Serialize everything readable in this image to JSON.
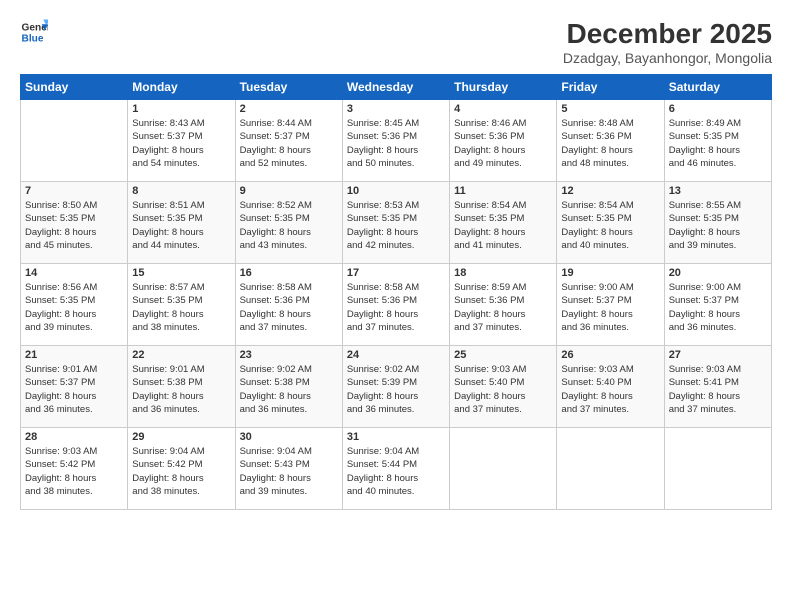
{
  "logo": {
    "line1": "General",
    "line2": "Blue"
  },
  "title": "December 2025",
  "location": "Dzadgay, Bayanhongor, Mongolia",
  "days_header": [
    "Sunday",
    "Monday",
    "Tuesday",
    "Wednesday",
    "Thursday",
    "Friday",
    "Saturday"
  ],
  "weeks": [
    [
      {
        "num": "",
        "info": ""
      },
      {
        "num": "1",
        "info": "Sunrise: 8:43 AM\nSunset: 5:37 PM\nDaylight: 8 hours\nand 54 minutes."
      },
      {
        "num": "2",
        "info": "Sunrise: 8:44 AM\nSunset: 5:37 PM\nDaylight: 8 hours\nand 52 minutes."
      },
      {
        "num": "3",
        "info": "Sunrise: 8:45 AM\nSunset: 5:36 PM\nDaylight: 8 hours\nand 50 minutes."
      },
      {
        "num": "4",
        "info": "Sunrise: 8:46 AM\nSunset: 5:36 PM\nDaylight: 8 hours\nand 49 minutes."
      },
      {
        "num": "5",
        "info": "Sunrise: 8:48 AM\nSunset: 5:36 PM\nDaylight: 8 hours\nand 48 minutes."
      },
      {
        "num": "6",
        "info": "Sunrise: 8:49 AM\nSunset: 5:35 PM\nDaylight: 8 hours\nand 46 minutes."
      }
    ],
    [
      {
        "num": "7",
        "info": "Sunrise: 8:50 AM\nSunset: 5:35 PM\nDaylight: 8 hours\nand 45 minutes."
      },
      {
        "num": "8",
        "info": "Sunrise: 8:51 AM\nSunset: 5:35 PM\nDaylight: 8 hours\nand 44 minutes."
      },
      {
        "num": "9",
        "info": "Sunrise: 8:52 AM\nSunset: 5:35 PM\nDaylight: 8 hours\nand 43 minutes."
      },
      {
        "num": "10",
        "info": "Sunrise: 8:53 AM\nSunset: 5:35 PM\nDaylight: 8 hours\nand 42 minutes."
      },
      {
        "num": "11",
        "info": "Sunrise: 8:54 AM\nSunset: 5:35 PM\nDaylight: 8 hours\nand 41 minutes."
      },
      {
        "num": "12",
        "info": "Sunrise: 8:54 AM\nSunset: 5:35 PM\nDaylight: 8 hours\nand 40 minutes."
      },
      {
        "num": "13",
        "info": "Sunrise: 8:55 AM\nSunset: 5:35 PM\nDaylight: 8 hours\nand 39 minutes."
      }
    ],
    [
      {
        "num": "14",
        "info": "Sunrise: 8:56 AM\nSunset: 5:35 PM\nDaylight: 8 hours\nand 39 minutes."
      },
      {
        "num": "15",
        "info": "Sunrise: 8:57 AM\nSunset: 5:35 PM\nDaylight: 8 hours\nand 38 minutes."
      },
      {
        "num": "16",
        "info": "Sunrise: 8:58 AM\nSunset: 5:36 PM\nDaylight: 8 hours\nand 37 minutes."
      },
      {
        "num": "17",
        "info": "Sunrise: 8:58 AM\nSunset: 5:36 PM\nDaylight: 8 hours\nand 37 minutes."
      },
      {
        "num": "18",
        "info": "Sunrise: 8:59 AM\nSunset: 5:36 PM\nDaylight: 8 hours\nand 37 minutes."
      },
      {
        "num": "19",
        "info": "Sunrise: 9:00 AM\nSunset: 5:37 PM\nDaylight: 8 hours\nand 36 minutes."
      },
      {
        "num": "20",
        "info": "Sunrise: 9:00 AM\nSunset: 5:37 PM\nDaylight: 8 hours\nand 36 minutes."
      }
    ],
    [
      {
        "num": "21",
        "info": "Sunrise: 9:01 AM\nSunset: 5:37 PM\nDaylight: 8 hours\nand 36 minutes."
      },
      {
        "num": "22",
        "info": "Sunrise: 9:01 AM\nSunset: 5:38 PM\nDaylight: 8 hours\nand 36 minutes."
      },
      {
        "num": "23",
        "info": "Sunrise: 9:02 AM\nSunset: 5:38 PM\nDaylight: 8 hours\nand 36 minutes."
      },
      {
        "num": "24",
        "info": "Sunrise: 9:02 AM\nSunset: 5:39 PM\nDaylight: 8 hours\nand 36 minutes."
      },
      {
        "num": "25",
        "info": "Sunrise: 9:03 AM\nSunset: 5:40 PM\nDaylight: 8 hours\nand 37 minutes."
      },
      {
        "num": "26",
        "info": "Sunrise: 9:03 AM\nSunset: 5:40 PM\nDaylight: 8 hours\nand 37 minutes."
      },
      {
        "num": "27",
        "info": "Sunrise: 9:03 AM\nSunset: 5:41 PM\nDaylight: 8 hours\nand 37 minutes."
      }
    ],
    [
      {
        "num": "28",
        "info": "Sunrise: 9:03 AM\nSunset: 5:42 PM\nDaylight: 8 hours\nand 38 minutes."
      },
      {
        "num": "29",
        "info": "Sunrise: 9:04 AM\nSunset: 5:42 PM\nDaylight: 8 hours\nand 38 minutes."
      },
      {
        "num": "30",
        "info": "Sunrise: 9:04 AM\nSunset: 5:43 PM\nDaylight: 8 hours\nand 39 minutes."
      },
      {
        "num": "31",
        "info": "Sunrise: 9:04 AM\nSunset: 5:44 PM\nDaylight: 8 hours\nand 40 minutes."
      },
      {
        "num": "",
        "info": ""
      },
      {
        "num": "",
        "info": ""
      },
      {
        "num": "",
        "info": ""
      }
    ]
  ]
}
